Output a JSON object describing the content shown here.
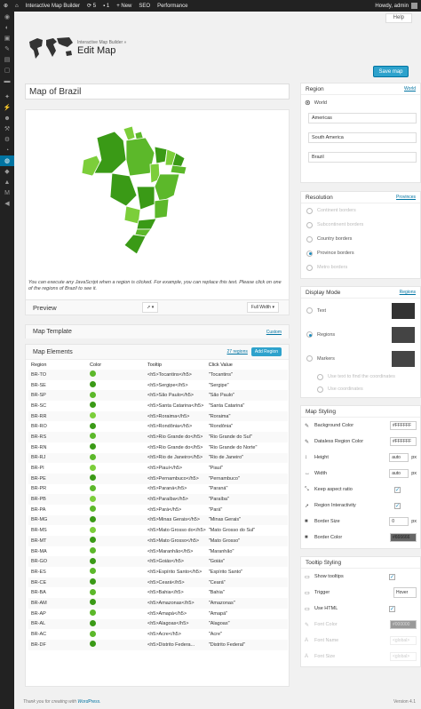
{
  "adminbar": {
    "site": "Interactive Map Builder",
    "updates": "5",
    "comments": "1",
    "new": "New",
    "seo": "SEO",
    "performance": "Performance",
    "howdy": "Howdy, admin"
  },
  "header": {
    "help": "Help",
    "subtitle": "Interactive Map Builder »",
    "title": "Edit Map",
    "save": "Save map"
  },
  "map": {
    "name": "Map of Brazil",
    "note": "You can execute any JavaScript when a region is clicked. For example, you can replace this text. Please click on one of the regions of Brazil to see it."
  },
  "preview": {
    "label": "Preview",
    "mode": "Full Width"
  },
  "template": {
    "label": "Map Template",
    "link": "Custom"
  },
  "elements": {
    "label": "Map Elements",
    "count": "27 regions",
    "add": "Add Region",
    "columns": [
      "Region",
      "Color",
      "Tooltip",
      "Click Value"
    ],
    "rows": [
      {
        "r": "BR-TO",
        "c": "#5cb82a",
        "t": "<h5>Tocantins</h5>",
        "v": "\"Tocantins\""
      },
      {
        "r": "BR-SE",
        "c": "#3a9a16",
        "t": "<h5>Sergipe</h5>",
        "v": "\"Sergipe\""
      },
      {
        "r": "BR-SP",
        "c": "#5cb82a",
        "t": "<h5>São Paulo</h5>",
        "v": "\"São Paulo\""
      },
      {
        "r": "BR-SC",
        "c": "#3a9a16",
        "t": "<h5>Santa Catarina</h5>",
        "v": "\"Santa Catarina\""
      },
      {
        "r": "BR-RR",
        "c": "#7cce3a",
        "t": "<h5>Roraima</h5>",
        "v": "\"Roraima\""
      },
      {
        "r": "BR-RO",
        "c": "#3a9a16",
        "t": "<h5>Rondônia</h5>",
        "v": "\"Rondônia\""
      },
      {
        "r": "BR-RS",
        "c": "#5cb82a",
        "t": "<h5>Rio Grande do</h5>",
        "v": "\"Rio Grande do Sul\""
      },
      {
        "r": "BR-RN",
        "c": "#3a9a16",
        "t": "<h5>Rio Grande do</h5>",
        "v": "\"Rio Grande do Norte\""
      },
      {
        "r": "BR-RJ",
        "c": "#5cb82a",
        "t": "<h5>Rio de Janeiro</h5>",
        "v": "\"Rio de Janeiro\""
      },
      {
        "r": "BR-PI",
        "c": "#7cce3a",
        "t": "<h5>Piauí</h5>",
        "v": "\"Piauí\""
      },
      {
        "r": "BR-PE",
        "c": "#3a9a16",
        "t": "<h5>Pernambuco</h5>",
        "v": "\"Pernambuco\""
      },
      {
        "r": "BR-PR",
        "c": "#5cb82a",
        "t": "<h5>Paraná</h5>",
        "v": "\"Paraná\""
      },
      {
        "r": "BR-PB",
        "c": "#7cce3a",
        "t": "<h5>Paraíba</h5>",
        "v": "\"Paraíba\""
      },
      {
        "r": "BR-PA",
        "c": "#5cb82a",
        "t": "<h5>Pará</h5>",
        "v": "\"Pará\""
      },
      {
        "r": "BR-MG",
        "c": "#3a9a16",
        "t": "<h5>Minas Gerais</h5>",
        "v": "\"Minas Gerais\""
      },
      {
        "r": "BR-MS",
        "c": "#7cce3a",
        "t": "<h5>Mato Grosso do</h5>",
        "v": "\"Mato Grosso do Sul\""
      },
      {
        "r": "BR-MT",
        "c": "#3a9a16",
        "t": "<h5>Mato Grosso</h5>",
        "v": "\"Mato Grosso\""
      },
      {
        "r": "BR-MA",
        "c": "#5cb82a",
        "t": "<h5>Maranhão</h5>",
        "v": "\"Maranhão\""
      },
      {
        "r": "BR-GO",
        "c": "#3a9a16",
        "t": "<h5>Goiás</h5>",
        "v": "\"Goiás\""
      },
      {
        "r": "BR-ES",
        "c": "#5cb82a",
        "t": "<h5>Espírito Santo</h5>",
        "v": "\"Espírito Santo\""
      },
      {
        "r": "BR-CE",
        "c": "#3a9a16",
        "t": "<h5>Ceará</h5>",
        "v": "\"Ceará\""
      },
      {
        "r": "BR-BA",
        "c": "#5cb82a",
        "t": "<h5>Bahia</h5>",
        "v": "\"Bahia\""
      },
      {
        "r": "BR-AM",
        "c": "#3a9a16",
        "t": "<h5>Amazonas</h5>",
        "v": "\"Amazonas\""
      },
      {
        "r": "BR-AP",
        "c": "#5cb82a",
        "t": "<h5>Amapá</h5>",
        "v": "\"Amapá\""
      },
      {
        "r": "BR-AL",
        "c": "#3a9a16",
        "t": "<h5>Alagoas</h5>",
        "v": "\"Alagoas\""
      },
      {
        "r": "BR-AC",
        "c": "#5cb82a",
        "t": "<h5>Acre</h5>",
        "v": "\"Acre\""
      },
      {
        "r": "BR-DF",
        "c": "#3a9a16",
        "t": "<h5>Distrito Federa...",
        "v": "\"Distrito Federal\""
      }
    ]
  },
  "region": {
    "label": "Region",
    "link": "World",
    "world": "World",
    "continent": "Americas",
    "subcontinent": "South America",
    "country": "Brazil"
  },
  "resolution": {
    "label": "Resolution",
    "link": "Provinces",
    "options": [
      "Continent borders",
      "Subcontinent borders",
      "Country borders",
      "Province borders",
      "Metro borders"
    ]
  },
  "display": {
    "label": "Display Mode",
    "link": "Regions",
    "options": [
      "Text",
      "Regions",
      "Markers"
    ],
    "sub": [
      "Use text to find the coordinates",
      "Use coordinates"
    ]
  },
  "styling": {
    "label": "Map Styling",
    "bg": "Background Color",
    "bg_val": "#FFFFFF",
    "dl": "Dataless Region Color",
    "dl_val": "#FFFFFF",
    "height": "Height",
    "height_val": "auto",
    "width": "Width",
    "width_val": "auto",
    "px": "px",
    "aspect": "Keep aspect ratio",
    "interactivity": "Region Interactivity",
    "bsize": "Border Size",
    "bsize_val": "0",
    "bcolor": "Border Color",
    "bcolor_val": "#666666"
  },
  "tooltip": {
    "label": "Tooltip Styling",
    "show": "Show tooltips",
    "trigger": "Trigger",
    "trigger_val": "Hover",
    "html": "Use HTML",
    "font_color": "Font Color",
    "font_color_val": "#000000",
    "font_name": "Font Name",
    "font_name_val": "<global>",
    "font_size": "Font Size",
    "font_size_val": "<global>"
  },
  "footer": {
    "thanks": "Thank you for creating with",
    "wp": "WordPress.",
    "version": "Version 4.1"
  }
}
